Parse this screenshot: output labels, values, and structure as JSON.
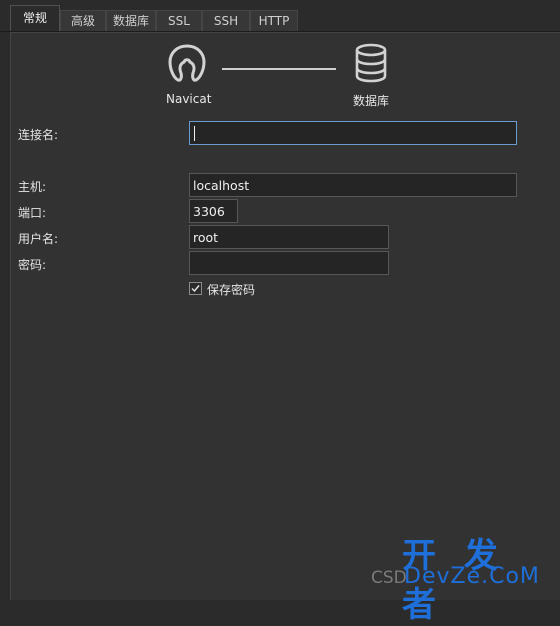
{
  "tabs": [
    "常规",
    "高级",
    "数据库",
    "SSL",
    "SSH",
    "HTTP"
  ],
  "header": {
    "left_caption": "Navicat",
    "right_caption": "数据库"
  },
  "form": {
    "connection_name_label": "连接名:",
    "connection_name_value": "",
    "host_label": "主机:",
    "host_value": "localhost",
    "port_label": "端口:",
    "port_value": "3306",
    "user_label": "用户名:",
    "user_value": "root",
    "password_label": "密码:",
    "password_value": "",
    "save_password_label": "保存密码",
    "save_password_checked": true
  },
  "watermark": {
    "big": "开 发 者",
    "small": "DevZe.CoM",
    "csdn": "CSD"
  },
  "icons": {
    "app": "navicat-icon",
    "db": "database-icon",
    "check": "checkmark-icon"
  },
  "colors": {
    "background": "#2b2b2b",
    "panel": "#323232",
    "focus_border": "#6a9bd0",
    "watermark": "#1e6fd9"
  }
}
